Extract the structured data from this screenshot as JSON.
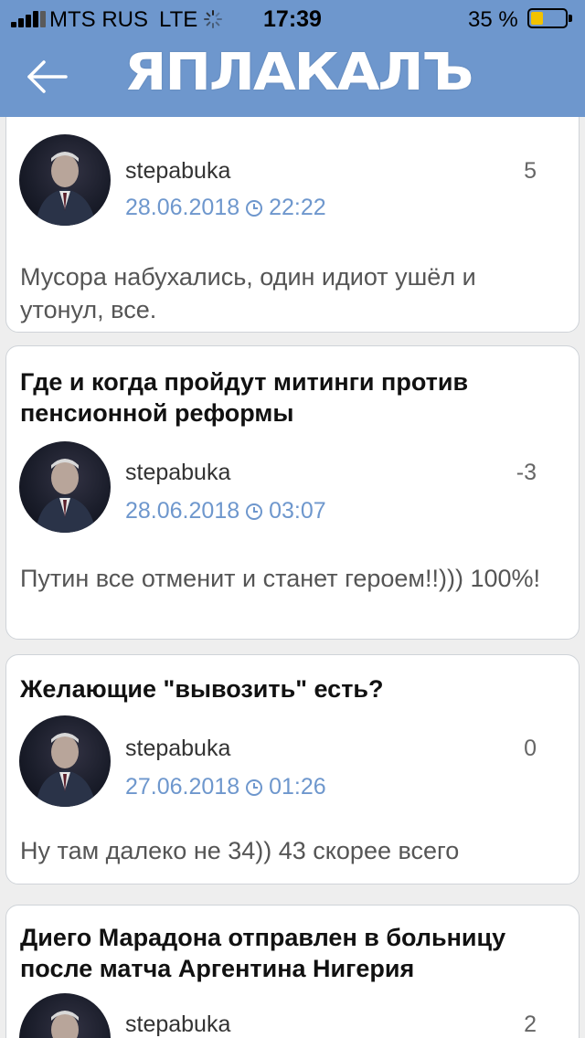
{
  "status_bar": {
    "carrier": "MTS RUS",
    "network": "LTE",
    "time": "17:39",
    "battery_percent_label": "35 %",
    "battery_level": 0.35
  },
  "nav": {
    "back_icon": "arrow-left-icon",
    "logo_text": "ЯПЛАКАЛЪ",
    "colors": {
      "bar": "#6e97cd",
      "accent": "#6e97cd"
    }
  },
  "posts": [
    {
      "title": "",
      "author": "stepabuka",
      "score": "5",
      "date": "28.06.2018",
      "time": "22:22",
      "comment": "Мусора набухались, один идиот ушёл и утонул, все."
    },
    {
      "title": "Где и когда пройдут митинги против пенсионной реформы",
      "author": "stepabuka",
      "score": "-3",
      "date": "28.06.2018",
      "time": "03:07",
      "comment": "Путин все отменит и станет героем!!))) 100%!"
    },
    {
      "title": "Желающие \"вывозить\" есть?",
      "author": "stepabuka",
      "score": "0",
      "date": "27.06.2018",
      "time": "01:26",
      "comment": "Ну там далеко не 34)) 43 скорее всего"
    },
    {
      "title": "Диего Марадона отправлен в больницу после матча Аргентина Нигерия",
      "author": "stepabuka",
      "score": "2",
      "date": "",
      "time": "",
      "comment": ""
    }
  ]
}
